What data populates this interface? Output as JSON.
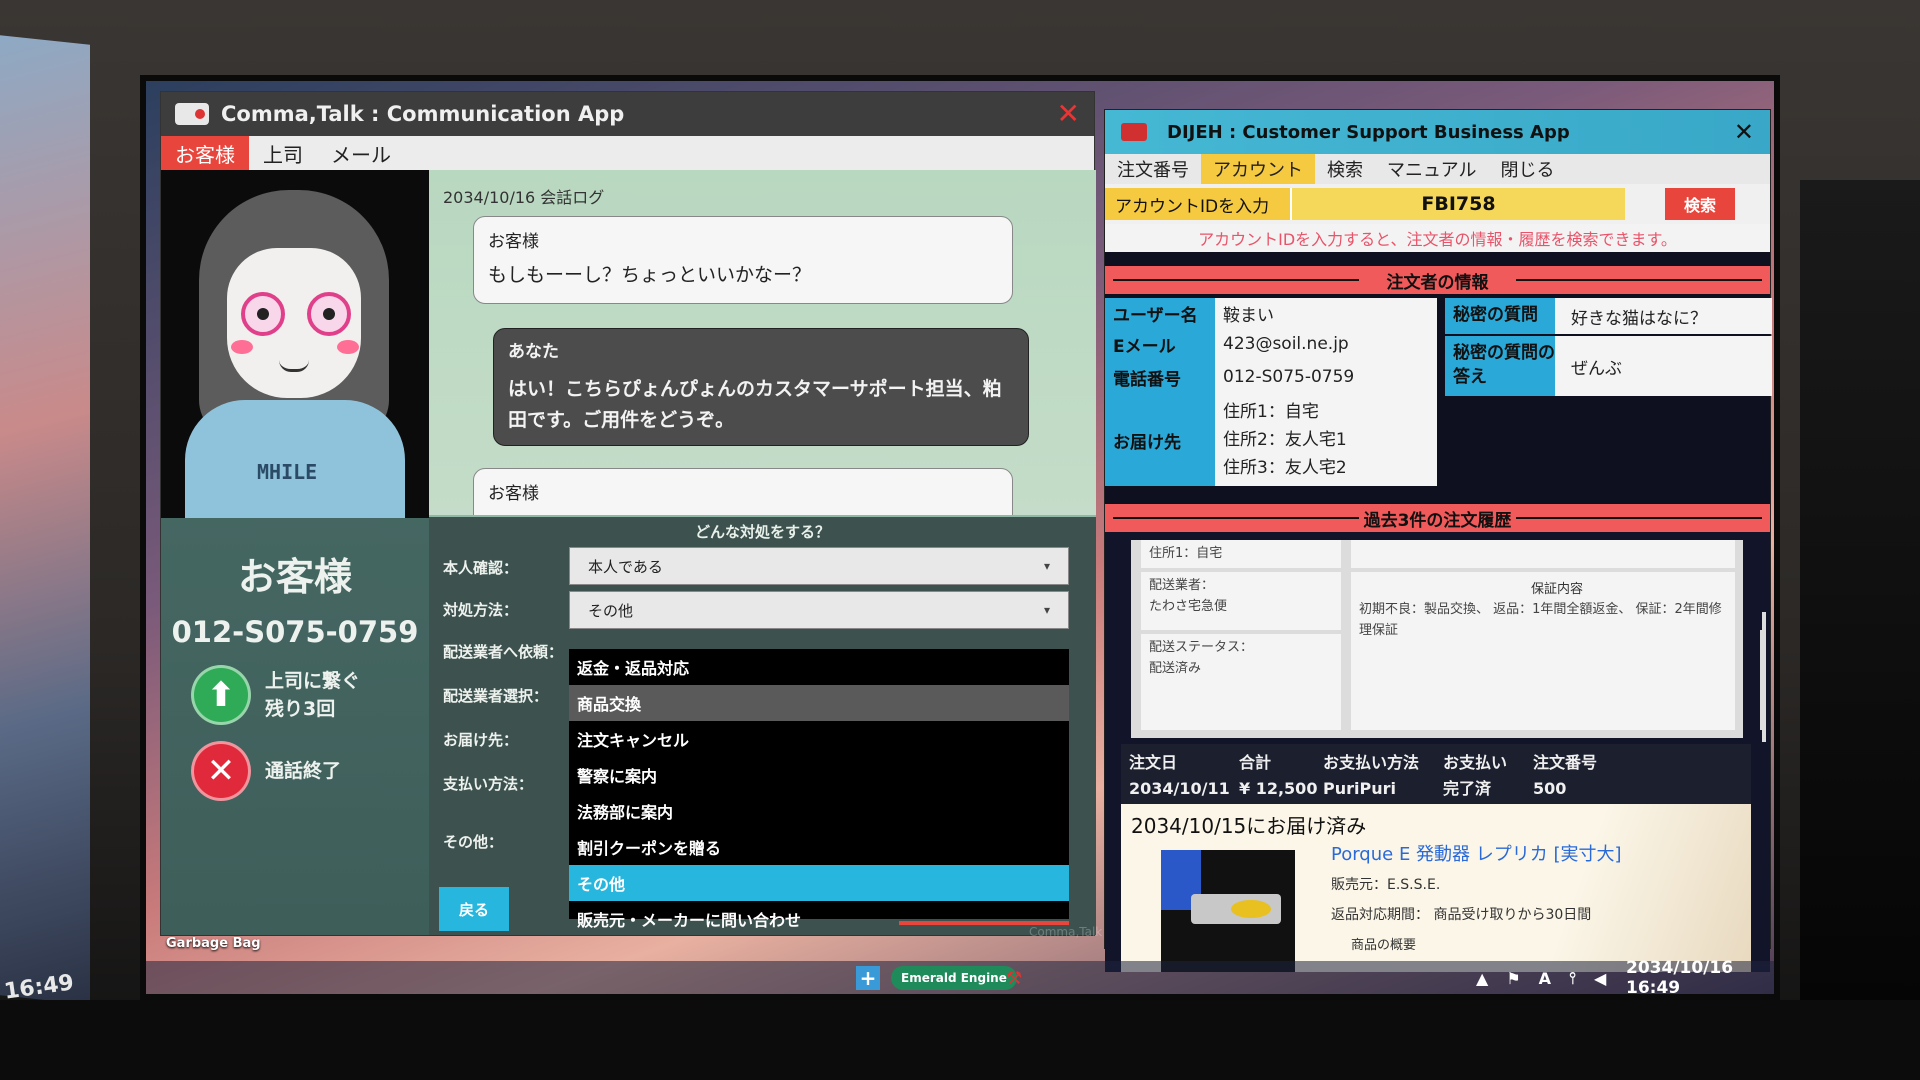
{
  "desktop": {
    "left_clock": "16:49",
    "desktop_icon_label": "Garbage Bag"
  },
  "comma_app": {
    "title": "Comma,Talk : Communication App",
    "close": "✕",
    "tabs": [
      {
        "label": "お客様",
        "active": true
      },
      {
        "label": "上司",
        "active": false
      },
      {
        "label": "メール",
        "active": false
      }
    ],
    "caller": {
      "hoodie_text": "MHILE",
      "name": "お客様",
      "phone": "012-S075-0759",
      "escalate_label_1": "上司に繋ぐ",
      "escalate_label_2": "残り3回",
      "escalate_icon": "⬆",
      "end_call_label": "通話終了",
      "end_call_icon": "✕"
    },
    "chat": {
      "date": "2034/10/16  会話ログ",
      "messages": [
        {
          "speaker": "お客様",
          "text": "もしもーーし？ちょっといいかなー？"
        },
        {
          "speaker": "あなた",
          "text": "はい！こちらぴょんぴょんのカスタマーサポート担当、粕田です。ご用件をどうぞ。"
        },
        {
          "speaker": "お客様",
          "text": ""
        }
      ]
    },
    "form": {
      "title": "どんな対処をする？",
      "labels": [
        "本人確認：",
        "対処方法：",
        "配送業者へ依頼：",
        "配送業者選択：",
        "お届け先：",
        "支払い方法：",
        "その他："
      ],
      "identity_value": "本人である",
      "method_value": "その他",
      "caret": "▾",
      "dropdown_options": [
        {
          "label": "返金・返品対応",
          "state": "normal"
        },
        {
          "label": "商品交換",
          "state": "hover"
        },
        {
          "label": "注文キャンセル",
          "state": "normal"
        },
        {
          "label": "警察に案内",
          "state": "normal"
        },
        {
          "label": "法務部に案内",
          "state": "normal"
        },
        {
          "label": "割引クーポンを贈る",
          "state": "normal"
        },
        {
          "label": "その他",
          "state": "selected"
        },
        {
          "label": "販売元・メーカーに問い合わせ",
          "state": "normal"
        }
      ],
      "back_label": "戻る",
      "watermark": "Comma,Talk"
    }
  },
  "dijeh_app": {
    "title": "DIJEH : Customer Support Business App",
    "close": "✕",
    "tabs": [
      {
        "label": "注文番号",
        "active": false
      },
      {
        "label": "アカウント",
        "active": true
      },
      {
        "label": "検索",
        "active": false
      },
      {
        "label": "マニュアル",
        "active": false
      },
      {
        "label": "閉じる",
        "active": false
      }
    ],
    "account_label": "アカウントIDを入力",
    "account_value": "FBI758",
    "search_button": "検索",
    "hint": "アカウントIDを入力すると、注文者の情報・履歴を検索できます。",
    "orderer_section": "注文者の情報",
    "info": {
      "username_key": "ユーザー名",
      "username": "鞍まい",
      "email_key": "Eメール",
      "email": "423@soil.ne.jp",
      "phone_key": "電話番号",
      "phone": "012-S075-0759",
      "address_key": "お届け先",
      "addresses": [
        "住所1：自宅",
        "住所2：友人宅1",
        "住所3：友人宅2"
      ],
      "secret_q_key": "秘密の質問",
      "secret_q": "好きな猫はなに？",
      "secret_a_key": "秘密の質問の答え",
      "secret_a": "ぜんぶ"
    },
    "history_section": "過去3件の注文履歴",
    "history": {
      "card_address": "住所1：自宅",
      "carrier_label": "配送業者：",
      "carrier": "たわさ宅急便",
      "status_label": "配送ステータス：",
      "status": "配送済み",
      "warranty_title": "保証内容",
      "warranty": "初期不良：製品交換、 返品：1年間全額返金、 保証：2年間修理保証"
    },
    "order_table": {
      "headers": [
        "注文日",
        "合計",
        "お支払い方法",
        "お支払い",
        "注文番号"
      ],
      "values": [
        "2034/10/11",
        "¥ 12,500",
        "PuriPuri",
        "完了済",
        "500"
      ]
    },
    "product": {
      "delivered": "2034/10/15にお届け済み",
      "name": "Porque E 発動器 レプリカ [実寸大]",
      "seller": "販売元：E.S.S.E.",
      "return_period": "返品対応期間：  商品受け取りから30日間",
      "summary": "商品の概要"
    }
  },
  "taskbar": {
    "plus": "+",
    "engine": "Emerald Engine",
    "tool": "⚒",
    "tray": [
      "▲",
      "⚑",
      "A",
      "⫯",
      "◀"
    ],
    "datetime": "2034/10/16  16:49"
  },
  "colors": {
    "accent_red": "#e8453c",
    "accent_cyan": "#27b6de",
    "accent_yellow": "#f5c940"
  }
}
